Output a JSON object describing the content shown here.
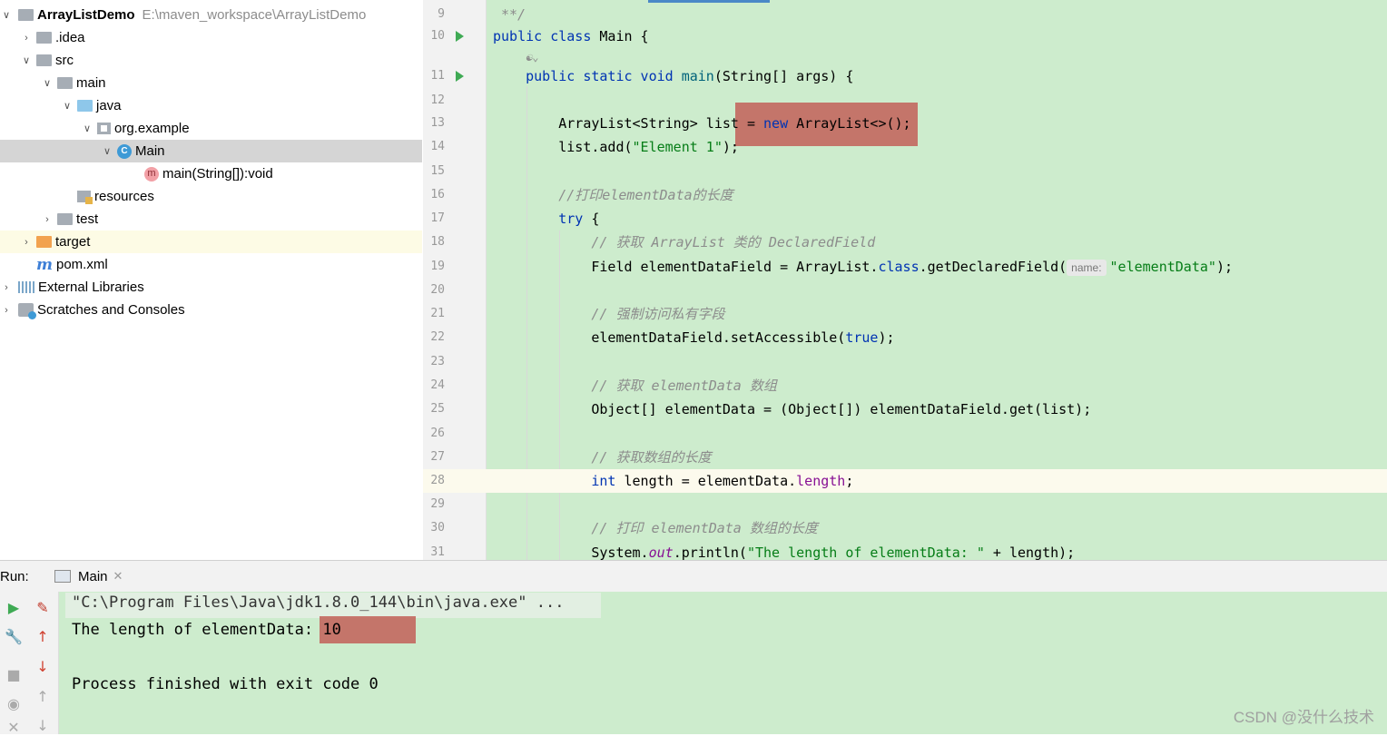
{
  "project_tree": {
    "root_name": "ArrayListDemo",
    "root_path": "E:\\maven_workspace\\ArrayListDemo",
    "items": [
      {
        "label": "ArrayListDemo",
        "depth": 0
      },
      {
        "label": ".idea",
        "depth": 1
      },
      {
        "label": "src",
        "depth": 1
      },
      {
        "label": "main",
        "depth": 2
      },
      {
        "label": "java",
        "depth": 3
      },
      {
        "label": "org.example",
        "depth": 4
      },
      {
        "label": "Main",
        "depth": 5
      },
      {
        "label": "main(String[]):void",
        "depth": 6
      },
      {
        "label": "resources",
        "depth": 3
      },
      {
        "label": "test",
        "depth": 2
      },
      {
        "label": "target",
        "depth": 1
      },
      {
        "label": "pom.xml",
        "depth": 1
      },
      {
        "label": "External Libraries",
        "depth": 0
      },
      {
        "label": "Scratches and Consoles",
        "depth": 0
      }
    ],
    "icons": {
      "class_letter": "C",
      "method_letter": "m",
      "maven_letter": "m"
    }
  },
  "editor": {
    "line_numbers": [
      "9",
      "10",
      "11",
      "12",
      "13",
      "14",
      "15",
      "16",
      "17",
      "18",
      "19",
      "20",
      "21",
      "22",
      "23",
      "24",
      "25",
      "26",
      "27",
      "28",
      "29",
      "30",
      "31"
    ],
    "param_hint": "name:"
  },
  "run_panel": {
    "label": "Run:",
    "tab_title": "Main",
    "console_lines": [
      "\"C:\\Program Files\\Java\\jdk1.8.0_144\\bin\\java.exe\" ...",
      "The length of elementData: 10",
      "",
      "Process finished with exit code 0"
    ]
  },
  "watermark": "CSDN @没什么技术",
  "colors": {
    "editor_bg": "#cdeccd",
    "keyword": "#0033b3",
    "string": "#067d17",
    "comment": "#8c8c8c",
    "highlight_box": "#c26058"
  }
}
